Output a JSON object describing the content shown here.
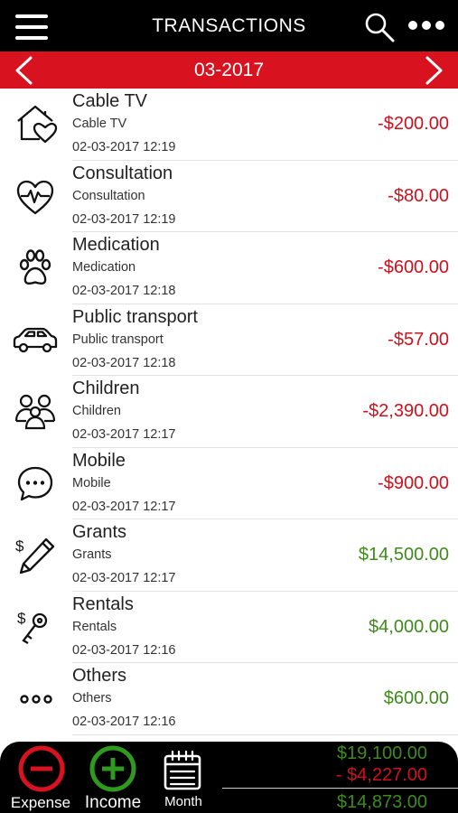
{
  "header": {
    "title": "TRANSACTIONS",
    "menu_icon": "hamburger-menu-icon",
    "search_icon": "search-icon",
    "more_icon": "more-dots-icon"
  },
  "month_bar": {
    "month": "03-2017",
    "prev_icon": "chevron-left-icon",
    "next_icon": "chevron-right-icon"
  },
  "colors": {
    "accent": "#d8121f",
    "expense": "#d0101c",
    "income": "#3f8a1c"
  },
  "transactions": [
    {
      "name": "Cable TV",
      "note": "Cable TV",
      "date": "02-03-2017 12:19",
      "amount": "-$200.00",
      "type": "expense",
      "icon": "house-heart-icon"
    },
    {
      "name": "Consultation",
      "note": "Consultation",
      "date": "02-03-2017 12:19",
      "amount": "-$80.00",
      "type": "expense",
      "icon": "heartbeat-icon"
    },
    {
      "name": "Medication",
      "note": "Medication",
      "date": "02-03-2017 12:18",
      "amount": "-$600.00",
      "type": "expense",
      "icon": "paw-icon"
    },
    {
      "name": "Public transport",
      "note": "Public transport",
      "date": "02-03-2017 12:18",
      "amount": "-$57.00",
      "type": "expense",
      "icon": "car-icon"
    },
    {
      "name": "Children",
      "note": "Children",
      "date": "02-03-2017 12:17",
      "amount": "-$2,390.00",
      "type": "expense",
      "icon": "family-icon"
    },
    {
      "name": "Mobile",
      "note": "Mobile",
      "date": "02-03-2017 12:17",
      "amount": "-$900.00",
      "type": "expense",
      "icon": "chat-bubble-icon"
    },
    {
      "name": "Grants",
      "note": "Grants",
      "date": "02-03-2017 12:17",
      "amount": "$14,500.00",
      "type": "income",
      "icon": "dollar-pencil-icon"
    },
    {
      "name": "Rentals",
      "note": "Rentals",
      "date": "02-03-2017 12:16",
      "amount": "$4,000.00",
      "type": "income",
      "icon": "dollar-key-icon"
    },
    {
      "name": "Others",
      "note": "Others",
      "date": "02-03-2017 12:16",
      "amount": "$600.00",
      "type": "income",
      "icon": "dots-icon"
    }
  ],
  "bottom_bar": {
    "expense_label": "Expense",
    "income_label": "Income",
    "month_label": "Month",
    "expense_icon": "minus-circle-icon",
    "income_icon": "plus-circle-icon",
    "month_icon": "calendar-icon"
  },
  "totals": {
    "income": "$19,100.00",
    "expense": "- $4,227.00",
    "balance": "$14,873.00"
  }
}
